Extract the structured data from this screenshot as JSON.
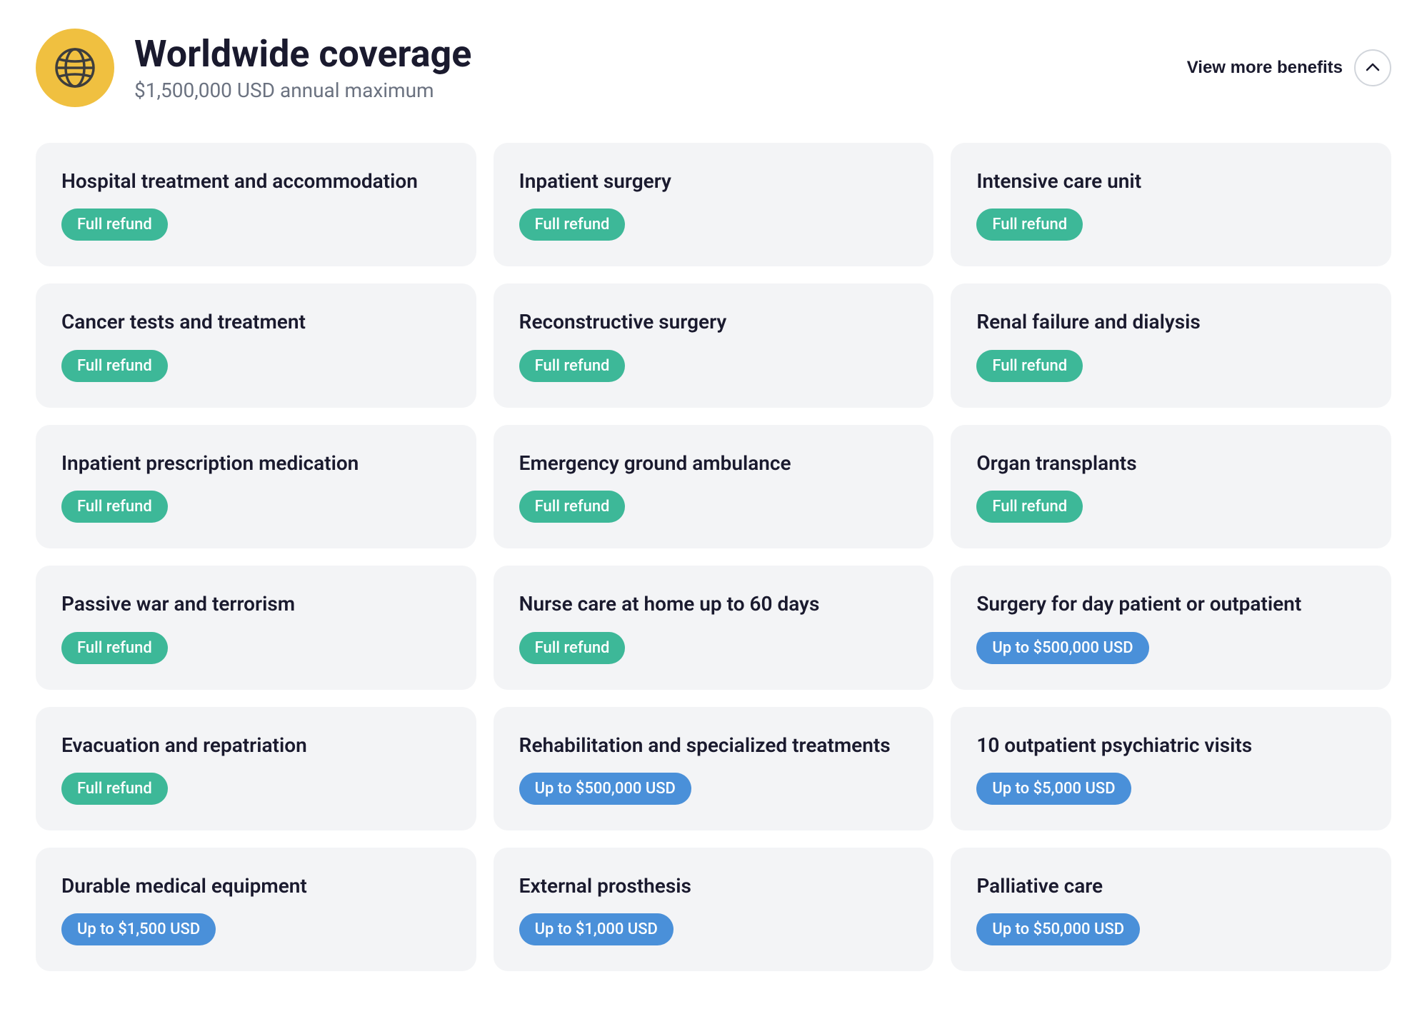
{
  "header": {
    "title": "Worldwide coverage",
    "subtitle": "$1,500,000 USD annual maximum",
    "view_more_label": "View more benefits",
    "globe_icon": "globe-icon"
  },
  "cards": [
    {
      "id": "hospital-treatment",
      "title": "Hospital treatment and accommodation",
      "badge": "Full refund",
      "badge_type": "green"
    },
    {
      "id": "inpatient-surgery",
      "title": "Inpatient surgery",
      "badge": "Full refund",
      "badge_type": "green"
    },
    {
      "id": "intensive-care-unit",
      "title": "Intensive care unit",
      "badge": "Full refund",
      "badge_type": "green"
    },
    {
      "id": "cancer-tests",
      "title": "Cancer tests and treatment",
      "badge": "Full refund",
      "badge_type": "green"
    },
    {
      "id": "reconstructive-surgery",
      "title": "Reconstructive surgery",
      "badge": "Full refund",
      "badge_type": "green"
    },
    {
      "id": "renal-failure",
      "title": "Renal failure and dialysis",
      "badge": "Full refund",
      "badge_type": "green"
    },
    {
      "id": "inpatient-prescription",
      "title": "Inpatient prescription medication",
      "badge": "Full refund",
      "badge_type": "green"
    },
    {
      "id": "emergency-ambulance",
      "title": "Emergency ground ambulance",
      "badge": "Full refund",
      "badge_type": "green"
    },
    {
      "id": "organ-transplants",
      "title": "Organ transplants",
      "badge": "Full refund",
      "badge_type": "green"
    },
    {
      "id": "passive-war",
      "title": "Passive war and terrorism",
      "badge": "Full refund",
      "badge_type": "green"
    },
    {
      "id": "nurse-care",
      "title": "Nurse care at home up to 60 days",
      "badge": "Full refund",
      "badge_type": "green"
    },
    {
      "id": "surgery-day-patient",
      "title": "Surgery for day patient or outpatient",
      "badge": "Up to $500,000 USD",
      "badge_type": "blue"
    },
    {
      "id": "evacuation-repatriation",
      "title": "Evacuation and repatriation",
      "badge": "Full refund",
      "badge_type": "green"
    },
    {
      "id": "rehabilitation",
      "title": "Rehabilitation and specialized treatments",
      "badge": "Up to $500,000 USD",
      "badge_type": "blue"
    },
    {
      "id": "outpatient-psychiatric",
      "title": "10 outpatient psychiatric visits",
      "badge": "Up to $5,000 USD",
      "badge_type": "blue"
    },
    {
      "id": "durable-medical",
      "title": "Durable medical equipment",
      "badge": "Up to $1,500 USD",
      "badge_type": "blue"
    },
    {
      "id": "external-prosthesis",
      "title": "External prosthesis",
      "badge": "Up to $1,000 USD",
      "badge_type": "blue"
    },
    {
      "id": "palliative-care",
      "title": "Palliative care",
      "badge": "Up to $50,000 USD",
      "badge_type": "blue"
    }
  ]
}
